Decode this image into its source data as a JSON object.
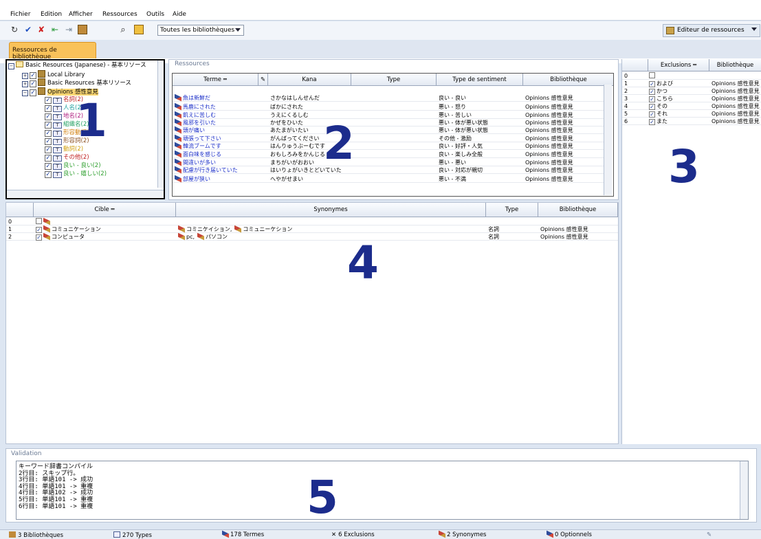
{
  "menu": [
    "Fichier",
    "Edition",
    "Afficher",
    "Ressources",
    "Outils",
    "Aide"
  ],
  "toolbar": {
    "library_select": "Toutes les bibliothèques",
    "editor_button": "Editeur de ressources"
  },
  "tab": "Ressources de bibliothèque",
  "tree": {
    "root": "Basic Resources (Japanese) - 基本リソース",
    "nodes": [
      {
        "label": "Local Library",
        "color": "#000000"
      },
      {
        "label": "Basic Resources 基本リソース",
        "color": "#000000"
      },
      {
        "label": "Opinions 感性意見",
        "color": "#000000"
      },
      {
        "label": "名詞(2)",
        "color": "#c02020"
      },
      {
        "label": "人名(2)",
        "color": "#20a0a0"
      },
      {
        "label": "地名(2)",
        "color": "#b02080"
      },
      {
        "label": "組織名(2)",
        "color": "#20a060"
      },
      {
        "label": "形容動詞(2)",
        "color": "#d08010"
      },
      {
        "label": "形容詞(2)",
        "color": "#8a5020"
      },
      {
        "label": "動詞(2)",
        "color": "#d0a010"
      },
      {
        "label": "その他(2)",
        "color": "#c02020"
      },
      {
        "label": "良い - 良い(2)",
        "color": "#30a030"
      },
      {
        "label": "良い - 嬉しい(2)",
        "color": "#30a030"
      }
    ]
  },
  "annotations": {
    "n1": "1",
    "n2": "2",
    "n3": "3",
    "n4": "4",
    "n5": "5"
  },
  "resources": {
    "legend": "Ressources",
    "headers": [
      "Terme",
      "Kana",
      "Type",
      "Type de sentiment",
      "Bibliothèque"
    ],
    "rows": [
      {
        "term": "魚は新鮮だ",
        "kana": "さかなはしんせんだ",
        "type": "",
        "sentiment": "良い - 良い",
        "lib": "Opinions 感性意見"
      },
      {
        "term": "馬鹿にされた",
        "kana": "ばかにされた",
        "type": "",
        "sentiment": "悪い - 怒り",
        "lib": "Opinions 感性意見"
      },
      {
        "term": "飢えに苦しむ",
        "kana": "うえにくるしむ",
        "type": "",
        "sentiment": "悪い - 苦しい",
        "lib": "Opinions 感性意見"
      },
      {
        "term": "風邪を引いた",
        "kana": "かぜをひいた",
        "type": "",
        "sentiment": "悪い - 体が悪い状態",
        "lib": "Opinions 感性意見"
      },
      {
        "term": "頭が痛い",
        "kana": "あたまがいたい",
        "type": "",
        "sentiment": "悪い - 体が悪い状態",
        "lib": "Opinions 感性意見"
      },
      {
        "term": "頑張って下さい",
        "kana": "がんばってください",
        "type": "",
        "sentiment": "その他 - 激励",
        "lib": "Opinions 感性意見"
      },
      {
        "term": "韓流ブームです",
        "kana": "はんりゅうぶーむです",
        "type": "",
        "sentiment": "良い - 好評・人気",
        "lib": "Opinions 感性意見"
      },
      {
        "term": "面白味を感じる",
        "kana": "おもしろみをかんじる",
        "type": "",
        "sentiment": "良い - 楽しみ全般",
        "lib": "Opinions 感性意見"
      },
      {
        "term": "間違いが多い",
        "kana": "まちがいがおおい",
        "type": "",
        "sentiment": "悪い - 悪い",
        "lib": "Opinions 感性意見"
      },
      {
        "term": "配慮が行き届いていた",
        "kana": "はいりょがいきとどいていた",
        "type": "",
        "sentiment": "良い - 対応が親切",
        "lib": "Opinions 感性意見"
      },
      {
        "term": "部屋が狭い",
        "kana": "へやがせまい",
        "type": "",
        "sentiment": "悪い - 不満",
        "lib": "Opinions 感性意見"
      }
    ]
  },
  "exclusions": {
    "headers": [
      "Exclusions",
      "Bibliothèque"
    ],
    "rows": [
      {
        "idx": "0",
        "word": "",
        "lib": "",
        "checked": false
      },
      {
        "idx": "1",
        "word": "および",
        "lib": "Opinions 感性意見",
        "checked": true
      },
      {
        "idx": "2",
        "word": "かつ",
        "lib": "Opinions 感性意見",
        "checked": true
      },
      {
        "idx": "3",
        "word": "こちら",
        "lib": "Opinions 感性意見",
        "checked": true
      },
      {
        "idx": "4",
        "word": "その",
        "lib": "Opinions 感性意見",
        "checked": true
      },
      {
        "idx": "5",
        "word": "それ",
        "lib": "Opinions 感性意見",
        "checked": true
      },
      {
        "idx": "6",
        "word": "また",
        "lib": "Opinions 感性意見",
        "checked": true
      }
    ]
  },
  "synonyms": {
    "headers": [
      "Cible",
      "Synonymes",
      "Type",
      "Bibliothèque"
    ],
    "rows": [
      {
        "idx": "0",
        "target": "",
        "syn1": "",
        "syn2": "",
        "type": "",
        "lib": "",
        "checked": false
      },
      {
        "idx": "1",
        "target": "コミュニケーション",
        "syn1": "コミニケイション,",
        "syn2": "コミュニーケション",
        "type": "名詞",
        "lib": "Opinions 感性意見",
        "checked": true
      },
      {
        "idx": "2",
        "target": "コンピュータ",
        "syn1": "pc,",
        "syn2": "パソコン",
        "type": "名詞",
        "lib": "Opinions 感性意見",
        "checked": true
      }
    ]
  },
  "validation": {
    "legend": "Validation",
    "lines": [
      "キーワード辞書コンパイル",
      "2行目: スキップ行。",
      "3行目: 単語101 -> 成功",
      "4行目: 単語101 -> 重複",
      "4行目: 単語102 -> 成功",
      "5行目: 単語101 -> 重複",
      "6行目: 単語101 -> 重複"
    ]
  },
  "status": {
    "libraries": "3 Bibliothèques",
    "types": "270 Types",
    "terms": "178 Termes",
    "exclusions": "6 Exclusions",
    "synonyms": "2 Synonymes",
    "optional": "0 Optionnels"
  },
  "icons": [
    "new-icon",
    "check-icon",
    "delete-icon",
    "import-icon",
    "export-icon",
    "book-icon",
    "find-icon",
    "edit-icon",
    "pin-icon",
    "pencil-icon"
  ],
  "colors": {
    "accent_tab": "#f9c25a",
    "annotation": "#1c2c8c",
    "term_link": "#1a2ec8"
  }
}
